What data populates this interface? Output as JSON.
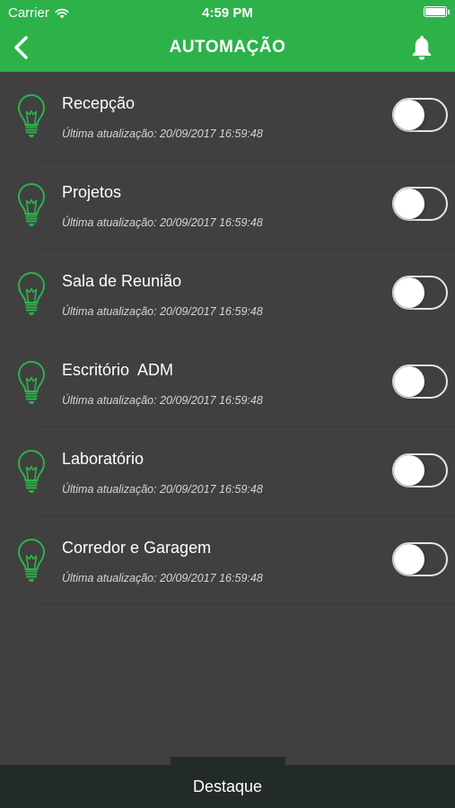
{
  "status_bar": {
    "carrier": "Carrier",
    "time": "4:59 PM"
  },
  "nav": {
    "title": "AUTOMAÇÃO",
    "back_icon": "chevron-left-icon",
    "bell_icon": "bell-icon"
  },
  "colors": {
    "accent": "#2db24a",
    "background": "#404040",
    "tabbar": "#232b29"
  },
  "devices": [
    {
      "name": "Recepção",
      "updated": "Última atualização: 20/09/2017 16:59:48",
      "on": false
    },
    {
      "name": "Projetos",
      "updated": "Última atualização: 20/09/2017 16:59:48",
      "on": false
    },
    {
      "name": "Sala de Reunião",
      "updated": "Última atualização: 20/09/2017 16:59:48",
      "on": false
    },
    {
      "name": "Escritório  ADM",
      "updated": "Última atualização: 20/09/2017 16:59:48",
      "on": false
    },
    {
      "name": "Laboratório",
      "updated": "Última atualização: 20/09/2017 16:59:48",
      "on": false
    },
    {
      "name": "Corredor e Garagem",
      "updated": "Última atualização: 20/09/2017 16:59:48",
      "on": false
    }
  ],
  "tab_bar": {
    "label": "Destaque"
  }
}
